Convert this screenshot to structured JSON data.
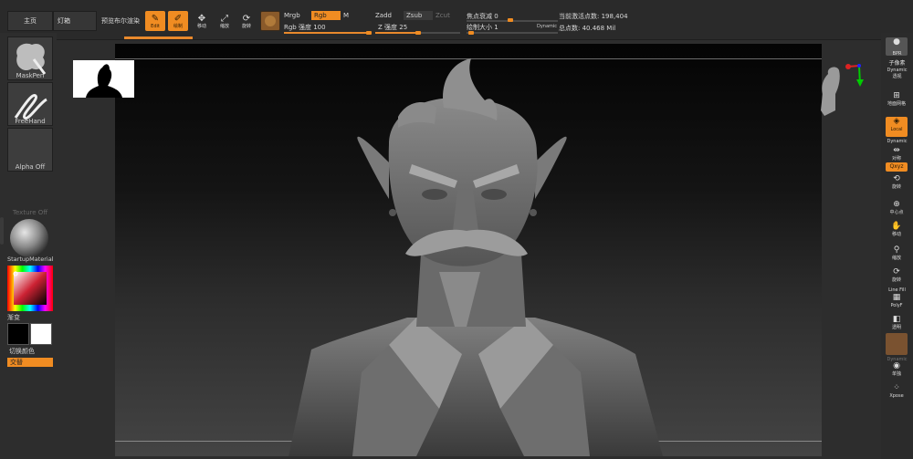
{
  "topbar": {
    "tabs": [
      "主页",
      "灯箱",
      "预览布尔渲染"
    ],
    "tools": [
      {
        "label": "Edit",
        "icon": "edit-icon",
        "active": true
      },
      {
        "label": "绘制",
        "icon": "draw-icon",
        "active": true
      },
      {
        "label": "移动",
        "icon": "move-icon",
        "active": false
      },
      {
        "label": "缩放",
        "icon": "scale-icon",
        "active": false
      },
      {
        "label": "旋转",
        "icon": "rotate-icon",
        "active": false
      }
    ],
    "mrgb": "Mrgb",
    "rgb": "Rgb",
    "m": "M",
    "rgb_intensity": "Rgb 强度 100",
    "zadd": "Zadd",
    "zsub": "Zsub",
    "zcut": "Zcut",
    "z_intensity": "Z 强度 25",
    "focal_shift": "焦点衰减 0",
    "draw_size": "绘制大小 1",
    "dynamic": "Dynamic",
    "active_points": "当前激活点数: 198,404",
    "total_points": "总点数: 40.468 Mil",
    "accent_color": "#f08c22"
  },
  "leftpanel": {
    "brush": "MaskPen",
    "stroke": "FreeHand",
    "alpha": "Alpha Off",
    "texture": "Texture Off",
    "material": "StartupMaterial",
    "gradient": "渐变",
    "switch_color": "切换颜色",
    "alternate": "交替"
  },
  "rightpanel": {
    "items": [
      "BPR",
      "子像素",
      "Dynamic",
      "透视",
      "地面网格",
      "Local",
      "Dynamic",
      "对称",
      "Qxyz",
      "旋转",
      "中心点",
      "移动",
      "缩放",
      "旋转",
      "Line Fill",
      "PolyF",
      "透明",
      "Dynamic",
      "单独",
      "Xpose"
    ]
  }
}
